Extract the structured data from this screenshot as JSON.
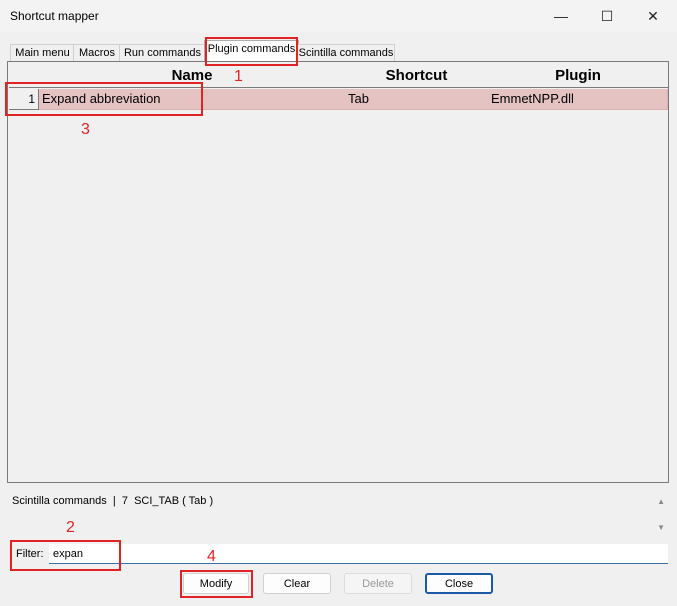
{
  "window": {
    "title": "Shortcut mapper",
    "minimize_glyph": "—",
    "maximize_glyph": "☐",
    "close_glyph": "✕"
  },
  "tabs": [
    {
      "label": "Main menu",
      "active": false
    },
    {
      "label": "Macros",
      "active": false
    },
    {
      "label": "Run commands",
      "active": false
    },
    {
      "label": "Plugin commands",
      "active": true
    },
    {
      "label": "Scintilla commands",
      "active": false
    }
  ],
  "table": {
    "headers": {
      "name": "Name",
      "shortcut": "Shortcut",
      "plugin": "Plugin"
    },
    "rows": [
      {
        "num": "1",
        "name": "Expand abbreviation",
        "shortcut": "Tab",
        "plugin": "EmmetNPP.dll"
      }
    ]
  },
  "info": {
    "text": "Scintilla commands  |  7  SCI_TAB ( Tab )"
  },
  "filter": {
    "label": "Filter:",
    "value": "expan"
  },
  "buttons": {
    "modify": "Modify",
    "clear": "Clear",
    "delete": "Delete",
    "close": "Close"
  },
  "annotations": [
    "1",
    "2",
    "3",
    "4"
  ],
  "colors": {
    "highlight_row": "#e6c3c3",
    "annotation": "#e02424",
    "default_button_border": "#1a5aa8"
  }
}
